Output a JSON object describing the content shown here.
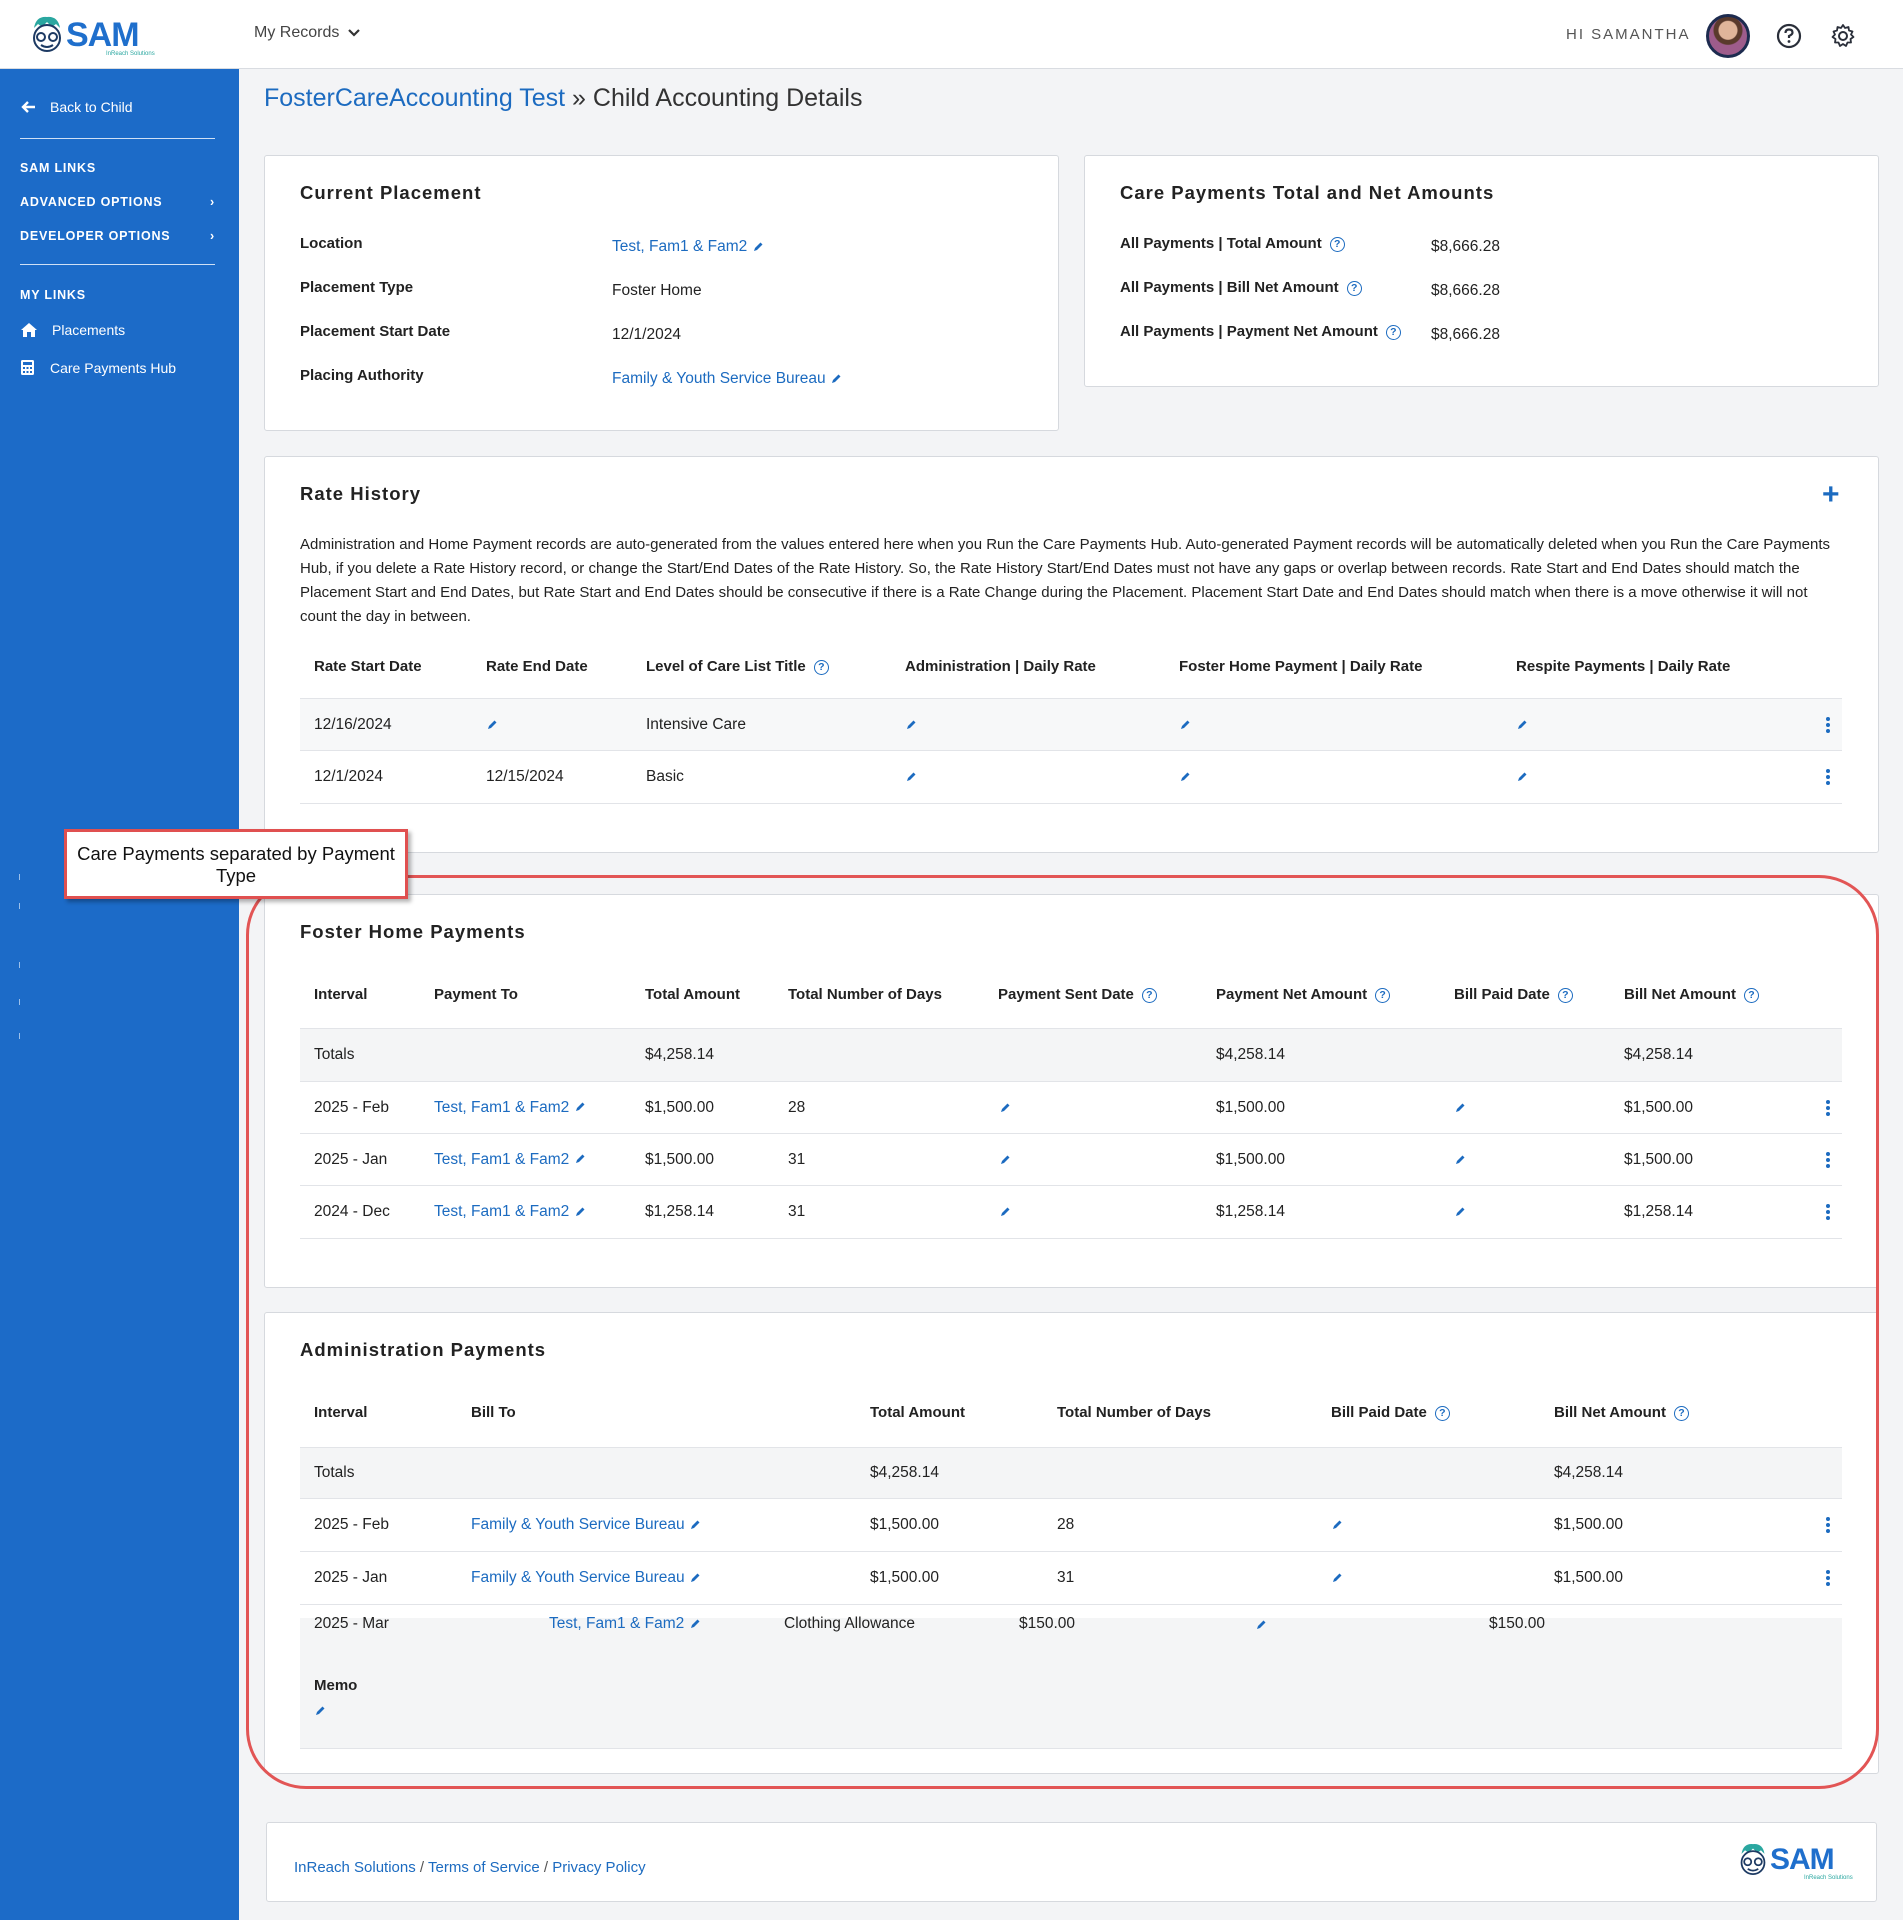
{
  "header": {
    "logo_text": "SAM",
    "logo_sub": "InReach Solutions",
    "my_records": "My Records",
    "greeting": "HI SAMANTHA"
  },
  "sidebar": {
    "back": "Back to Child",
    "sam_links": "SAM LINKS",
    "advanced": "ADVANCED OPTIONS",
    "developer": "DEVELOPER OPTIONS",
    "my_links": "MY LINKS",
    "placements": "Placements",
    "care_hub": "Care Payments Hub"
  },
  "breadcrumb": {
    "parent": "FosterCareAccounting Test",
    "sep": "»",
    "current": "Child Accounting Details"
  },
  "current_placement": {
    "title": "Current Placement",
    "rows": [
      {
        "label": "Location",
        "value": "Test, Fam1 & Fam2"
      },
      {
        "label": "Placement Type",
        "value": "Foster Home"
      },
      {
        "label": "Placement Start Date",
        "value": "12/1/2024"
      },
      {
        "label": "Placing Authority",
        "value": "Family & Youth Service Bureau"
      }
    ]
  },
  "totals": {
    "title": "Care Payments Total and Net Amounts",
    "rows": [
      {
        "label": "All Payments | Total Amount",
        "value": "$8,666.28"
      },
      {
        "label": "All Payments | Bill Net Amount",
        "value": "$8,666.28"
      },
      {
        "label": "All Payments | Payment Net Amount",
        "value": "$8,666.28"
      }
    ]
  },
  "rate_history": {
    "title": "Rate History",
    "description": "Administration and Home Payment records are auto-generated from the values entered here when you Run the Care Payments Hub. Auto-generated Payment records will be automatically deleted when you Run the Care Payments Hub, if you delete a Rate History record, or change the Start/End Dates of the Rate History. So, the Rate History Start/End Dates must not have any gaps or overlap between records. Rate Start and End Dates should match the Placement Start and End Dates, but Rate Start and End Dates should be consecutive if there is a Rate Change during the Placement. Placement Start Date and End Dates should match when there is a move otherwise it will not count the day in between.",
    "columns": [
      "Rate Start Date",
      "Rate End Date",
      "Level of Care List Title",
      "Administration | Daily Rate",
      "Foster Home Payment | Daily Rate",
      "Respite Payments | Daily Rate"
    ],
    "rows": [
      {
        "start": "12/16/2024",
        "end": "",
        "level": "Intensive Care"
      },
      {
        "start": "12/1/2024",
        "end": "12/15/2024",
        "level": "Basic"
      }
    ]
  },
  "callout": "Care Payments separated by Payment Type",
  "foster_home": {
    "title": "Foster Home Payments",
    "columns": [
      "Interval",
      "Payment To",
      "Total Amount",
      "Total Number of Days",
      "Payment Sent Date",
      "Payment Net Amount",
      "Bill Paid Date",
      "Bill Net Amount"
    ],
    "totals": {
      "label": "Totals",
      "total": "$4,258.14",
      "payment_net": "$4,258.14",
      "bill_net": "$4,258.14"
    },
    "rows": [
      {
        "interval": "2025 - Feb",
        "to": "Test, Fam1 & Fam2",
        "total": "$1,500.00",
        "days": "28",
        "payment_net": "$1,500.00",
        "bill_net": "$1,500.00"
      },
      {
        "interval": "2025 - Jan",
        "to": "Test, Fam1 & Fam2",
        "total": "$1,500.00",
        "days": "31",
        "payment_net": "$1,500.00",
        "bill_net": "$1,500.00"
      },
      {
        "interval": "2024 - Dec",
        "to": "Test, Fam1 & Fam2",
        "total": "$1,258.14",
        "days": "31",
        "payment_net": "$1,258.14",
        "bill_net": "$1,258.14"
      }
    ]
  },
  "admin": {
    "title": "Administration Payments",
    "columns": [
      "Interval",
      "Bill To",
      "Total Amount",
      "Total Number of Days",
      "Bill Paid Date",
      "Bill Net Amount"
    ],
    "totals": {
      "label": "Totals",
      "total": "$4,258.14",
      "bill_net": "$4,258.14"
    },
    "rows": [
      {
        "interval": "2025 - Feb",
        "to": "Family & Youth Service Bureau",
        "total": "$1,500.00",
        "days": "28",
        "bill_net": "$1,500.00"
      },
      {
        "interval": "2025 - Jan",
        "to": "Family & Youth Service Bureau",
        "total": "$1,500.00",
        "days": "31",
        "bill_net": "$1,500.00"
      }
    ],
    "extra": {
      "interval": "2025 - Mar",
      "to": "Test, Fam1 & Fam2",
      "type": "Clothing Allowance",
      "total": "$150.00",
      "net": "$150.00",
      "memo_label": "Memo"
    }
  },
  "footer": {
    "company": "InReach Solutions",
    "terms": "Terms of Service",
    "privacy": "Privacy Policy",
    "sep": "/"
  },
  "colors": {
    "primary": "#1c6bc8",
    "link": "#1c6bc0",
    "callout_border": "#e05050"
  }
}
